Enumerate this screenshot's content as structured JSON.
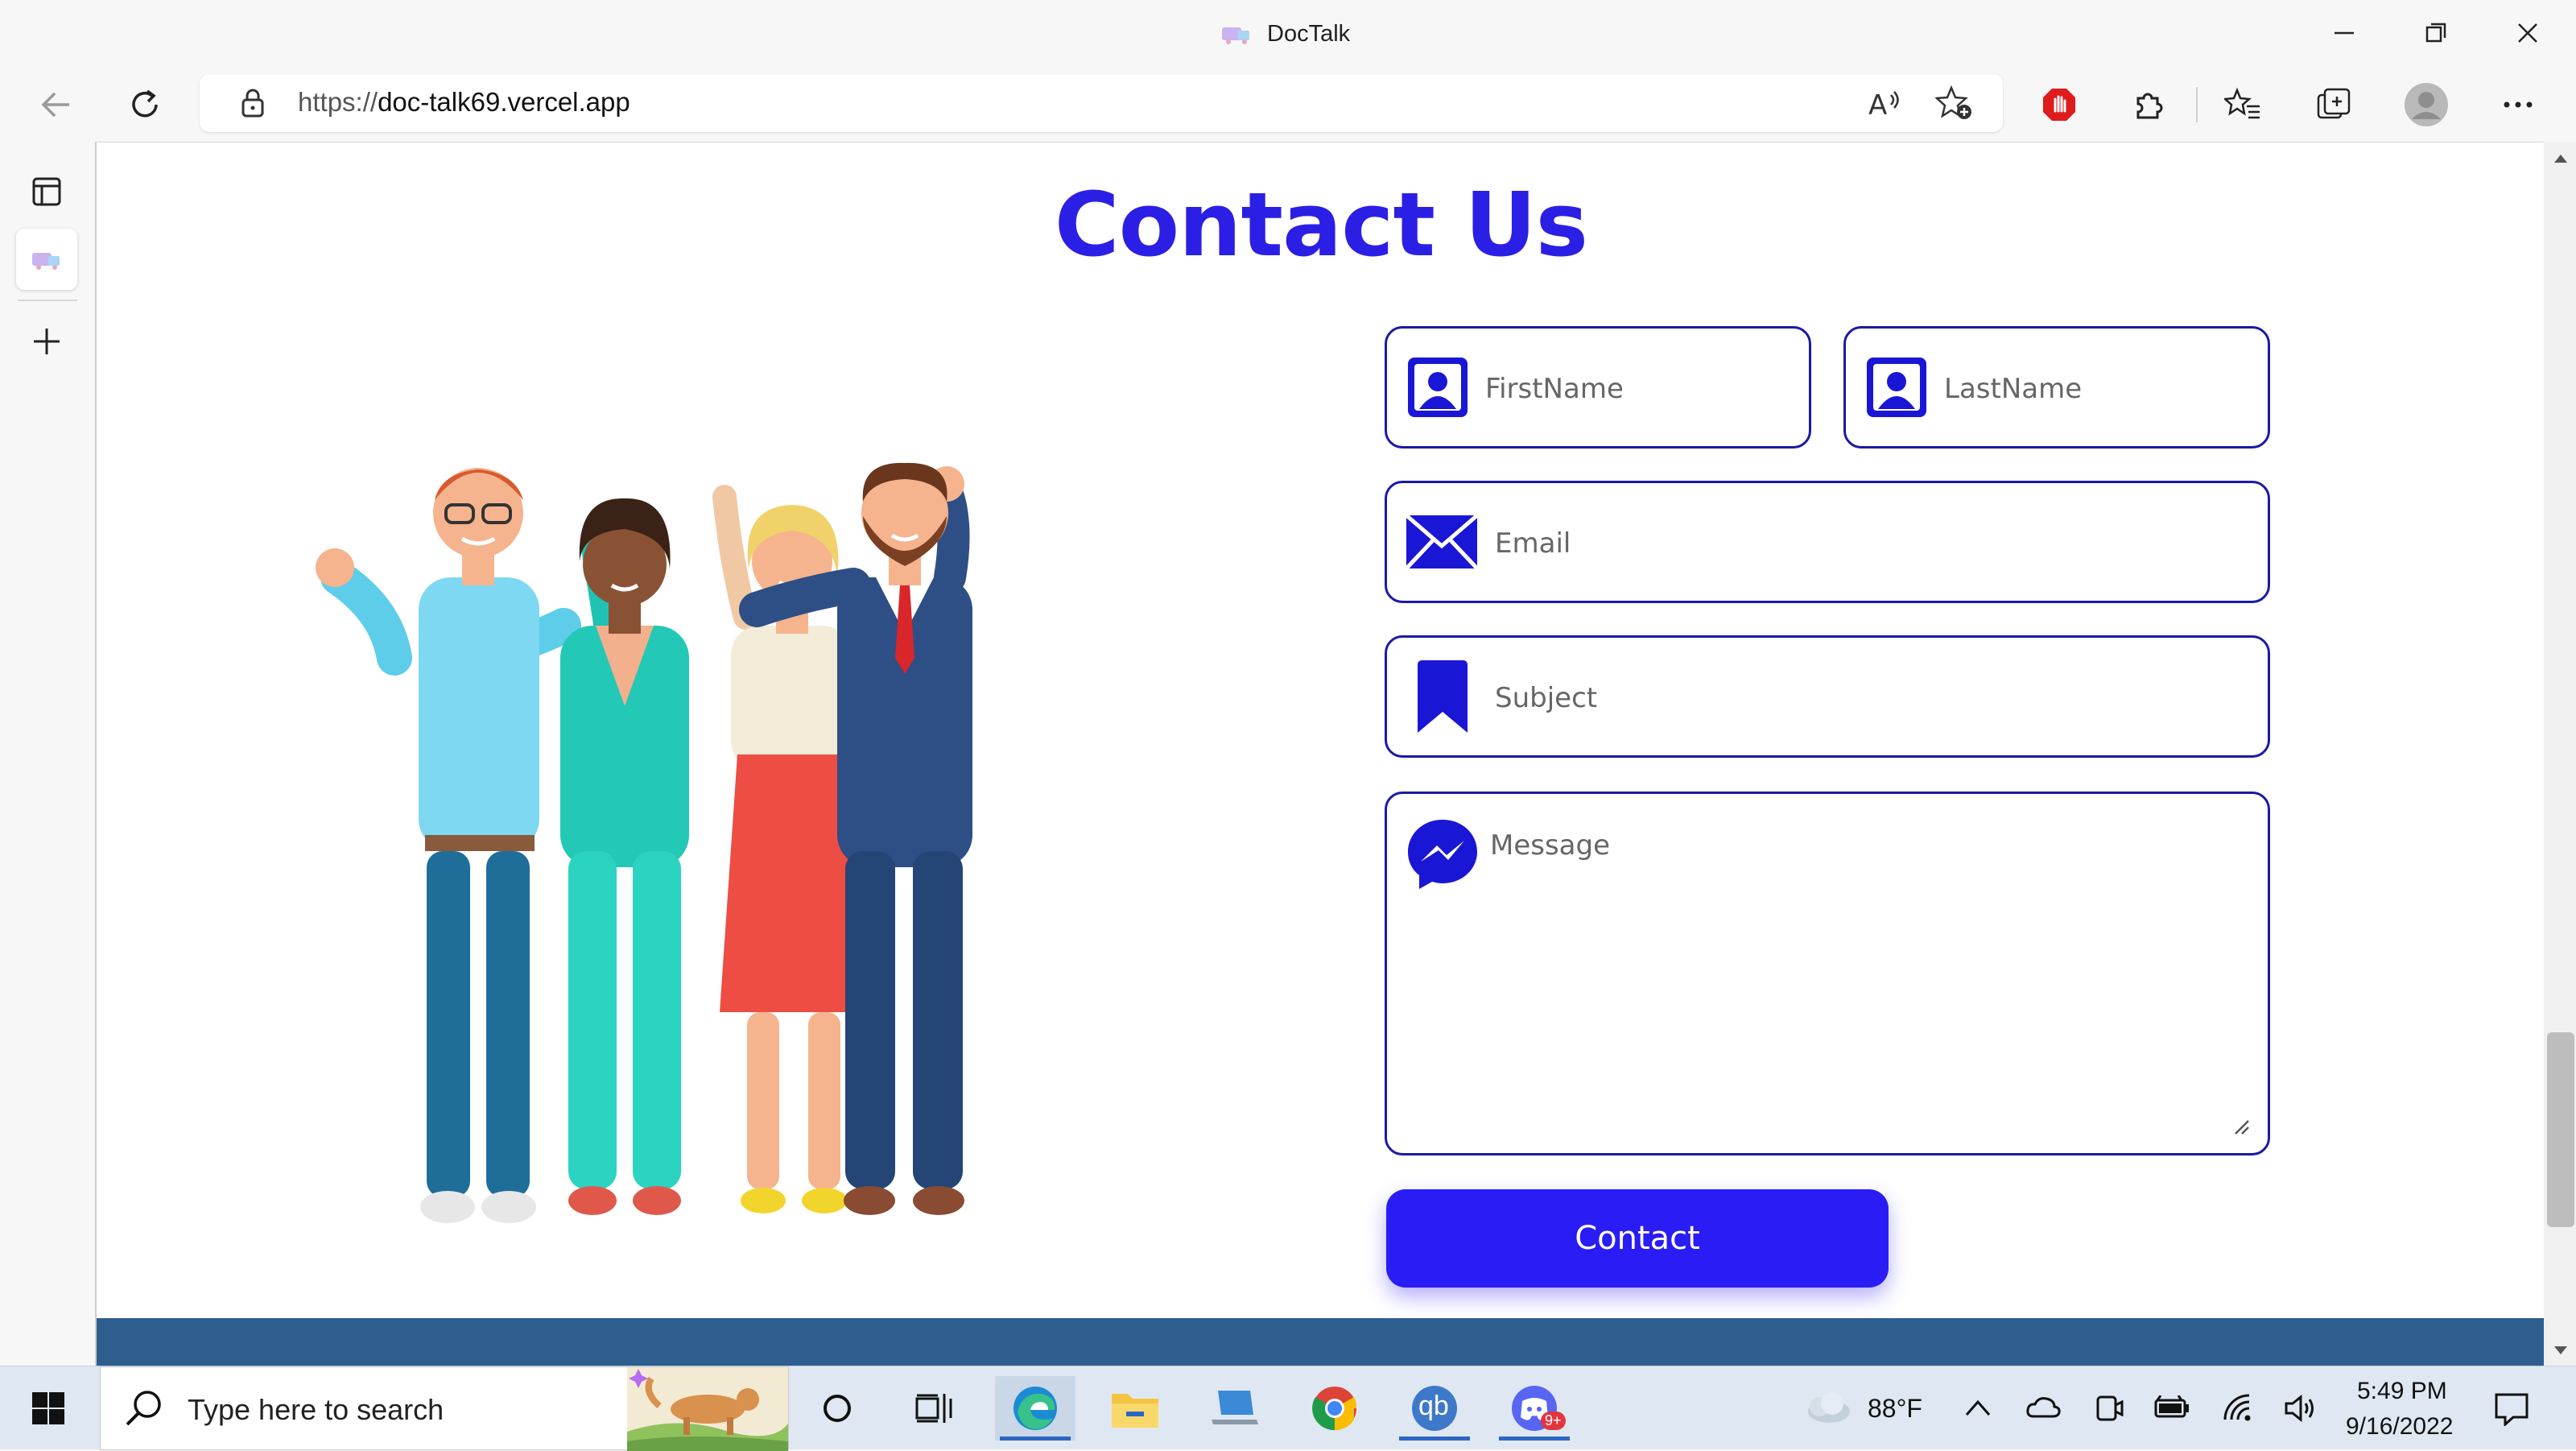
{
  "browser": {
    "window_title": "DocTalk",
    "url_protocol": "https://",
    "url_host": "doc-talk69.vercel.app"
  },
  "page": {
    "heading": "Contact Us",
    "form": {
      "first_name_placeholder": "FirstName",
      "last_name_placeholder": "LastName",
      "email_placeholder": "Email",
      "subject_placeholder": "Subject",
      "message_placeholder": "Message",
      "submit_label": "Contact"
    }
  },
  "taskbar": {
    "search_placeholder": "Type here to search",
    "weather": "88°F",
    "time": "5:49 PM",
    "date": "9/16/2022",
    "discord_badge": "9+",
    "qbittorrent_label": "qb"
  },
  "colors": {
    "accent": "#2b1fe6",
    "button": "#2a1cf5",
    "field_border": "#1a1aa6",
    "footer_band": "#2d5e8e"
  },
  "icons": {
    "name_field": "contact-card-icon",
    "email_field": "envelope-icon",
    "subject_field": "bookmark-icon",
    "message_field": "messenger-icon"
  }
}
